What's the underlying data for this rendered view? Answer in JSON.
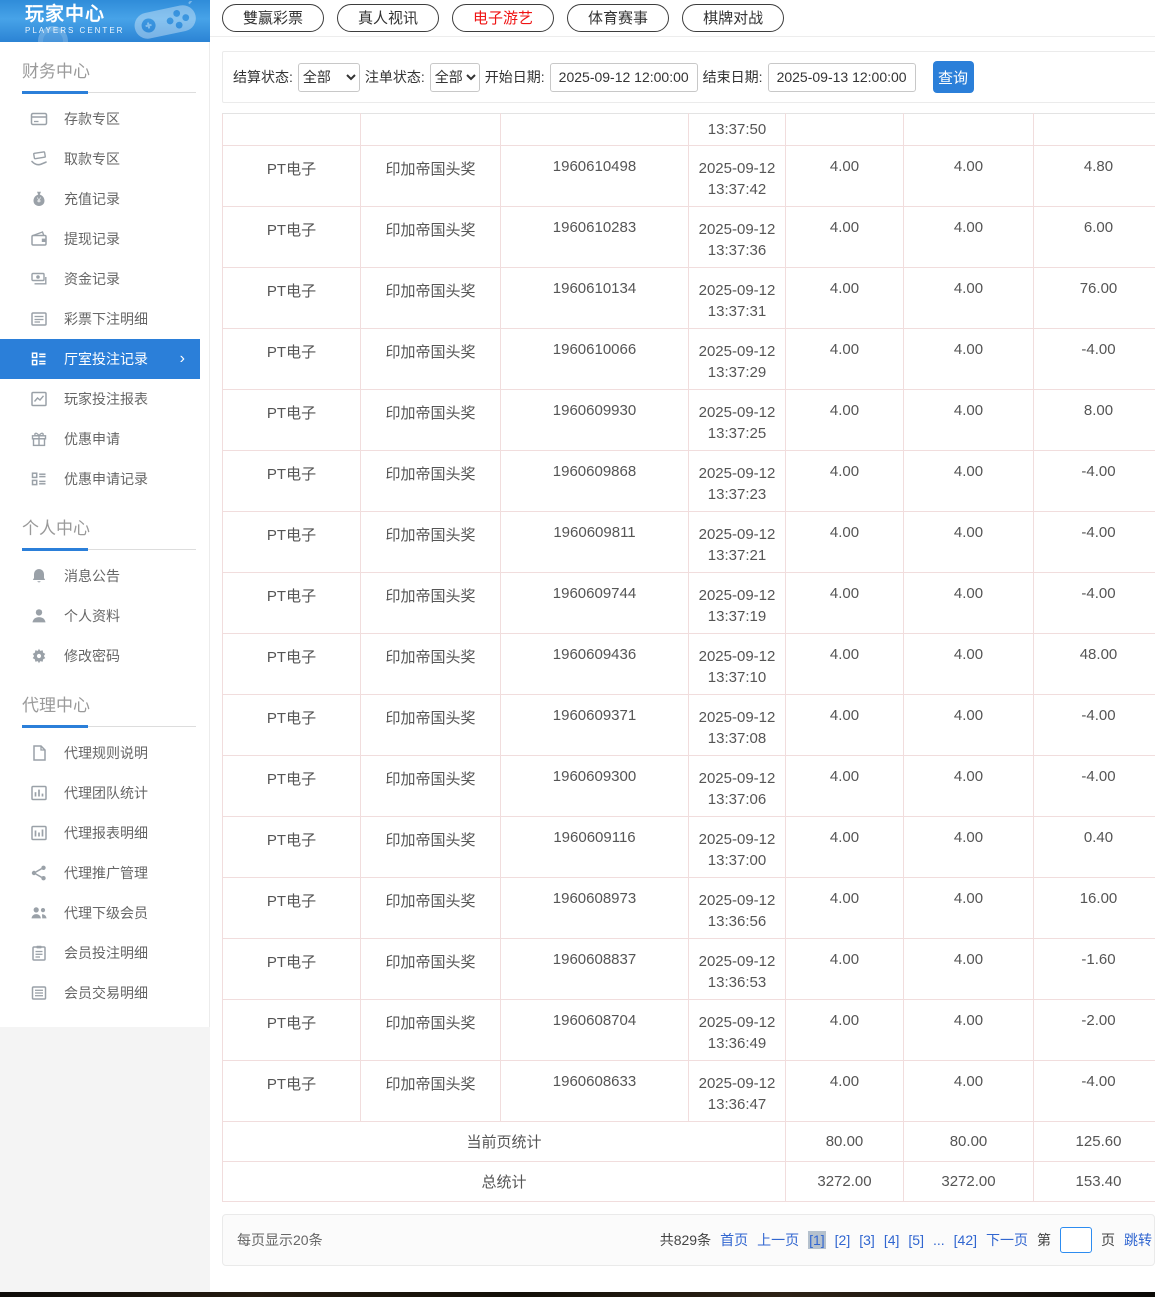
{
  "app": {
    "title": "玩家中心",
    "subtitle": "PLAYERS CENTER"
  },
  "accent_color": "#2b7fd9",
  "active_tab_color": "#ef1414",
  "sidebar": {
    "sections": [
      {
        "title": "财务中心",
        "items": [
          {
            "label": "存款专区",
            "icon": "deposit-card-icon"
          },
          {
            "label": "取款专区",
            "icon": "withdraw-hand-icon"
          },
          {
            "label": "充值记录",
            "icon": "moneybag-icon"
          },
          {
            "label": "提现记录",
            "icon": "wallet-icon"
          },
          {
            "label": "资金记录",
            "icon": "funds-icon"
          },
          {
            "label": "彩票下注明细",
            "icon": "lottery-list-icon"
          },
          {
            "label": "厅室投注记录",
            "icon": "hall-records-icon",
            "active": true,
            "chevron": "›"
          },
          {
            "label": "玩家投注报表",
            "icon": "player-report-icon"
          },
          {
            "label": "优惠申请",
            "icon": "promo-apply-icon"
          },
          {
            "label": "优惠申请记录",
            "icon": "promo-records-icon"
          }
        ]
      },
      {
        "title": "个人中心",
        "items": [
          {
            "label": "消息公告",
            "icon": "bell-icon"
          },
          {
            "label": "个人资料",
            "icon": "user-icon"
          },
          {
            "label": "修改密码",
            "icon": "gear-icon"
          }
        ]
      },
      {
        "title": "代理中心",
        "items": [
          {
            "label": "代理规则说明",
            "icon": "doc-icon"
          },
          {
            "label": "代理团队统计",
            "icon": "team-stats-icon"
          },
          {
            "label": "代理报表明细",
            "icon": "report-detail-icon"
          },
          {
            "label": "代理推广管理",
            "icon": "share-icon"
          },
          {
            "label": "代理下级会员",
            "icon": "members-icon"
          },
          {
            "label": "会员投注明细",
            "icon": "bet-detail-icon"
          },
          {
            "label": "会员交易明细",
            "icon": "trade-detail-icon"
          }
        ]
      }
    ]
  },
  "tabs": [
    {
      "key": "lottery",
      "label": "雙赢彩票"
    },
    {
      "key": "live-video",
      "label": "真人视讯"
    },
    {
      "key": "electronic-games",
      "label": "电子游艺",
      "active": true
    },
    {
      "key": "sports",
      "label": "体育赛事"
    },
    {
      "key": "board-games",
      "label": "棋牌对战"
    }
  ],
  "filters": {
    "settle_label": "结算状态:",
    "settle_value": "全部",
    "order_label": "注单状态:",
    "order_value": "全部",
    "start_label": "开始日期:",
    "start_value": "2025-09-12 12:00:00",
    "end_label": "结束日期:",
    "end_value": "2025-09-13 12:00:00",
    "search_label": "查询"
  },
  "table": {
    "partial_row": {
      "time": "13:37:50"
    },
    "rows": [
      {
        "platform": "PT电子",
        "game": "印加帝国头奖",
        "order": "1960610498",
        "date": "2025-09-12",
        "time": "13:37:42",
        "bet": "4.00",
        "valid": "4.00",
        "result": "4.80"
      },
      {
        "platform": "PT电子",
        "game": "印加帝国头奖",
        "order": "1960610283",
        "date": "2025-09-12",
        "time": "13:37:36",
        "bet": "4.00",
        "valid": "4.00",
        "result": "6.00"
      },
      {
        "platform": "PT电子",
        "game": "印加帝国头奖",
        "order": "1960610134",
        "date": "2025-09-12",
        "time": "13:37:31",
        "bet": "4.00",
        "valid": "4.00",
        "result": "76.00"
      },
      {
        "platform": "PT电子",
        "game": "印加帝国头奖",
        "order": "1960610066",
        "date": "2025-09-12",
        "time": "13:37:29",
        "bet": "4.00",
        "valid": "4.00",
        "result": "-4.00"
      },
      {
        "platform": "PT电子",
        "game": "印加帝国头奖",
        "order": "1960609930",
        "date": "2025-09-12",
        "time": "13:37:25",
        "bet": "4.00",
        "valid": "4.00",
        "result": "8.00"
      },
      {
        "platform": "PT电子",
        "game": "印加帝国头奖",
        "order": "1960609868",
        "date": "2025-09-12",
        "time": "13:37:23",
        "bet": "4.00",
        "valid": "4.00",
        "result": "-4.00"
      },
      {
        "platform": "PT电子",
        "game": "印加帝国头奖",
        "order": "1960609811",
        "date": "2025-09-12",
        "time": "13:37:21",
        "bet": "4.00",
        "valid": "4.00",
        "result": "-4.00"
      },
      {
        "platform": "PT电子",
        "game": "印加帝国头奖",
        "order": "1960609744",
        "date": "2025-09-12",
        "time": "13:37:19",
        "bet": "4.00",
        "valid": "4.00",
        "result": "-4.00"
      },
      {
        "platform": "PT电子",
        "game": "印加帝国头奖",
        "order": "1960609436",
        "date": "2025-09-12",
        "time": "13:37:10",
        "bet": "4.00",
        "valid": "4.00",
        "result": "48.00"
      },
      {
        "platform": "PT电子",
        "game": "印加帝国头奖",
        "order": "1960609371",
        "date": "2025-09-12",
        "time": "13:37:08",
        "bet": "4.00",
        "valid": "4.00",
        "result": "-4.00"
      },
      {
        "platform": "PT电子",
        "game": "印加帝国头奖",
        "order": "1960609300",
        "date": "2025-09-12",
        "time": "13:37:06",
        "bet": "4.00",
        "valid": "4.00",
        "result": "-4.00"
      },
      {
        "platform": "PT电子",
        "game": "印加帝国头奖",
        "order": "1960609116",
        "date": "2025-09-12",
        "time": "13:37:00",
        "bet": "4.00",
        "valid": "4.00",
        "result": "0.40"
      },
      {
        "platform": "PT电子",
        "game": "印加帝国头奖",
        "order": "1960608973",
        "date": "2025-09-12",
        "time": "13:36:56",
        "bet": "4.00",
        "valid": "4.00",
        "result": "16.00"
      },
      {
        "platform": "PT电子",
        "game": "印加帝国头奖",
        "order": "1960608837",
        "date": "2025-09-12",
        "time": "13:36:53",
        "bet": "4.00",
        "valid": "4.00",
        "result": "-1.60"
      },
      {
        "platform": "PT电子",
        "game": "印加帝国头奖",
        "order": "1960608704",
        "date": "2025-09-12",
        "time": "13:36:49",
        "bet": "4.00",
        "valid": "4.00",
        "result": "-2.00"
      },
      {
        "platform": "PT电子",
        "game": "印加帝国头奖",
        "order": "1960608633",
        "date": "2025-09-12",
        "time": "13:36:47",
        "bet": "4.00",
        "valid": "4.00",
        "result": "-4.00"
      }
    ],
    "page_summary": {
      "label": "当前页统计",
      "bet": "80.00",
      "valid": "80.00",
      "result": "125.60"
    },
    "total_summary": {
      "label": "总统计",
      "bet": "3272.00",
      "valid": "3272.00",
      "result": "153.40"
    }
  },
  "pagination": {
    "per_page": "每页显示20条",
    "total_count": "共829条",
    "links": [
      {
        "key": "first",
        "label": "首页"
      },
      {
        "key": "prev",
        "label": "上一页"
      },
      {
        "key": "1",
        "label": "[1]",
        "active": true
      },
      {
        "key": "2",
        "label": "[2]"
      },
      {
        "key": "3",
        "label": "[3]"
      },
      {
        "key": "4",
        "label": "[4]"
      },
      {
        "key": "5",
        "label": "[5]"
      },
      {
        "key": "ellipsis",
        "label": "...",
        "ellipsis": true
      },
      {
        "key": "42",
        "label": "[42]"
      },
      {
        "key": "next",
        "label": "下一页"
      }
    ],
    "jump_prefix": "第",
    "jump_value": "",
    "jump_suffix": "页",
    "jump_action": "跳转"
  }
}
